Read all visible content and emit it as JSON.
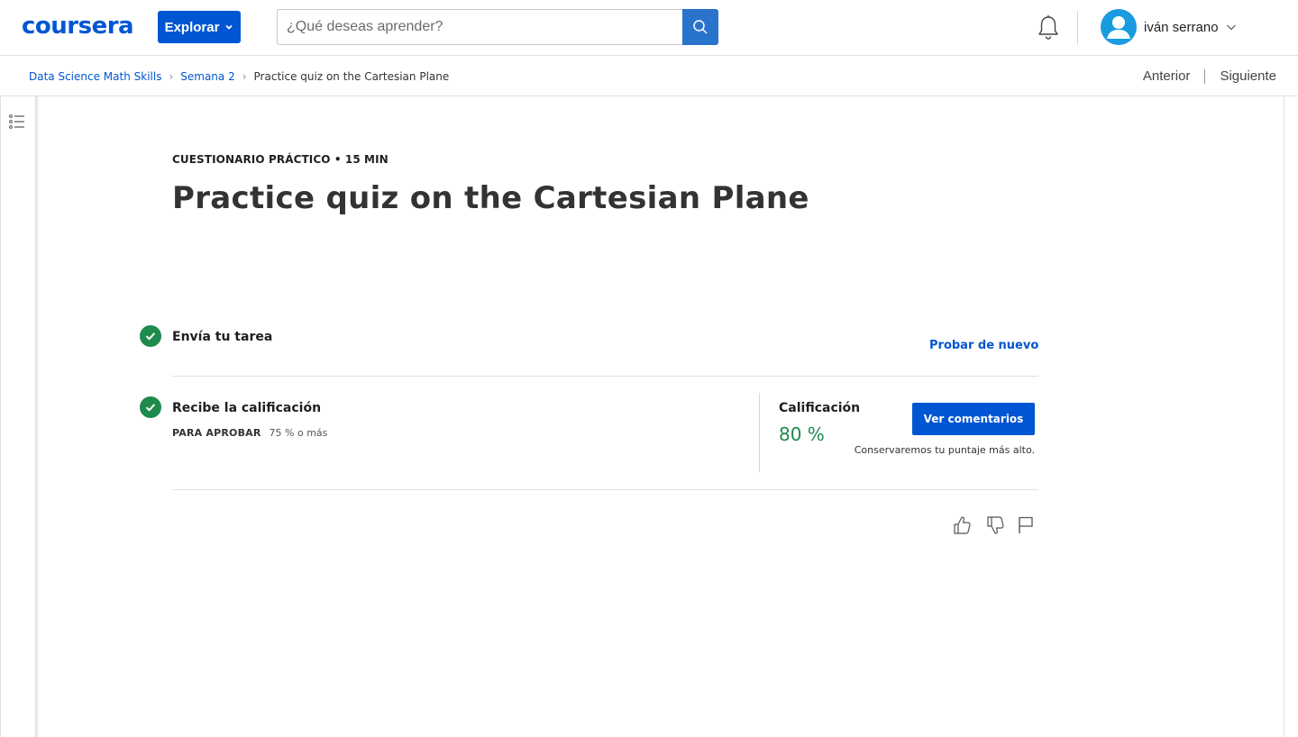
{
  "header": {
    "logo_text": "coursera",
    "explore_label": "Explorar",
    "search_placeholder": "¿Qué deseas aprender?",
    "user_name": "iván serrano",
    "brand_color": "#0056d2",
    "icons": [
      "search-icon",
      "bell-icon",
      "avatar-icon",
      "chevron-down-icon"
    ]
  },
  "breadcrumb": {
    "items": [
      "Data Science Math Skills",
      "Semana 2"
    ],
    "current": "Practice quiz on the Cartesian Plane"
  },
  "nav": {
    "previous": "Anterior",
    "next": "Siguiente"
  },
  "quiz": {
    "eyebrow": "CUESTIONARIO PRÁCTICO • 15 MIN",
    "title": "Practice quiz on the Cartesian Plane",
    "steps": [
      {
        "label": "Envía tu tarea",
        "status": "complete"
      },
      {
        "label": "Recibe la calificación",
        "status": "complete"
      }
    ],
    "retry_label": "Probar de nuevo",
    "pass_label": "PARA APROBAR",
    "pass_value": "75 % o más",
    "grade_label": "Calificación",
    "grade_value": "80 %",
    "feedback_button": "Ver comentarios",
    "keep_note": "Conservaremos tu puntaje más alto.",
    "success_color": "#1e8a4c"
  },
  "feedback_icons": [
    "thumbs-up-icon",
    "thumbs-down-icon",
    "flag-icon"
  ]
}
